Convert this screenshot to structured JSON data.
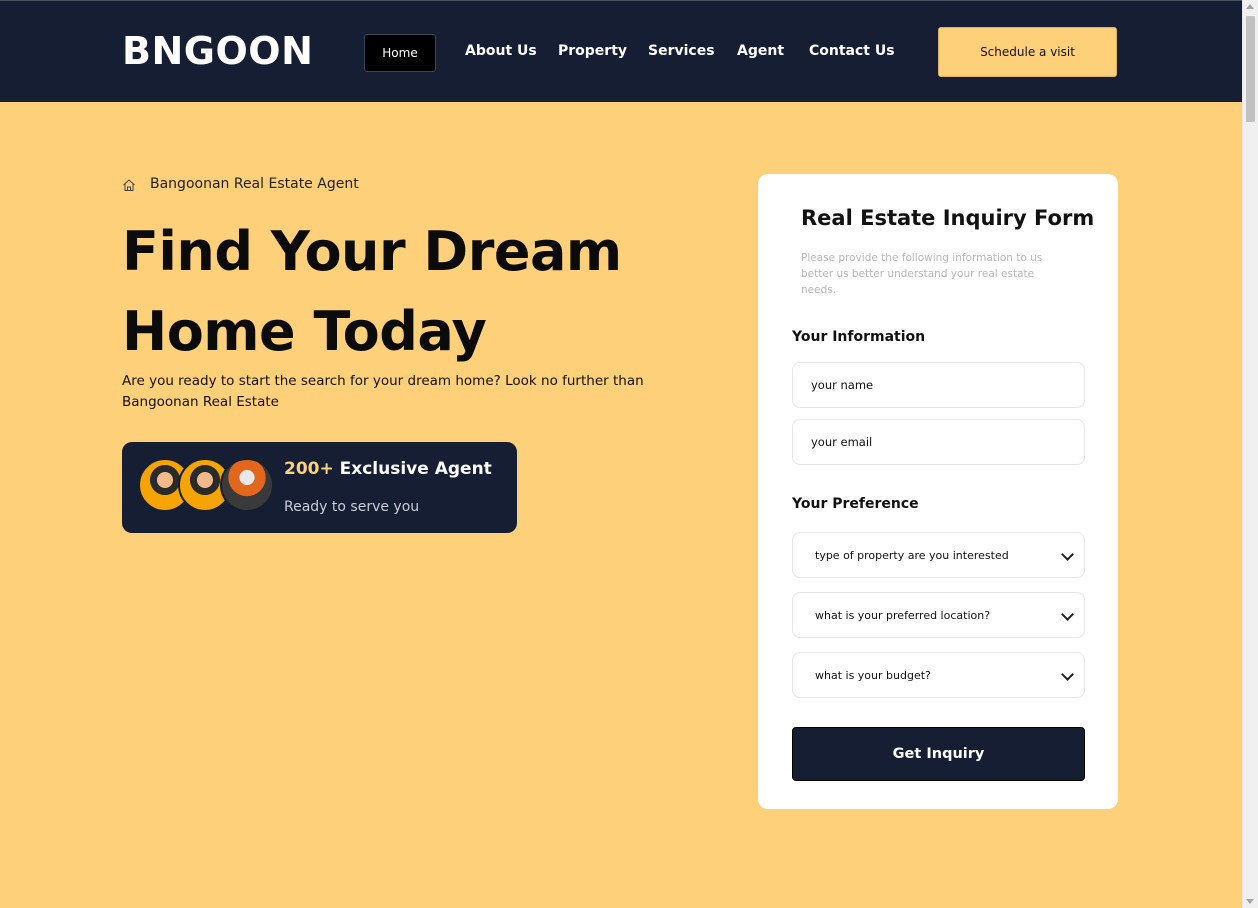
{
  "header": {
    "logo": "BNGOON",
    "nav": {
      "home": "Home",
      "about": "About Us",
      "property": "Property",
      "services": "Services",
      "agent": "Agent",
      "contact": "Contact Us"
    },
    "schedule_button": "Schedule a visit"
  },
  "hero": {
    "breadcrumb": "Bangoonan Real Estate Agent",
    "title": "Find Your Dream Home Today",
    "description": "Are you ready to start the search for your dream home? Look no further than Bangoonan Real Estate",
    "agent_card": {
      "count": "200+",
      "label": "Exclusive Agent",
      "subtitle": "Ready to serve you"
    }
  },
  "form": {
    "title": "Real Estate Inquiry Form",
    "description": "Please provide the following information to us better us better understand your real estate needs.",
    "info_label": "Your Information",
    "name_placeholder": "your name",
    "email_placeholder": "your email",
    "preference_label": "Your Preference",
    "property_type": "type of property are you interested",
    "location": "what is your preferred location?",
    "budget": "what is your budget?",
    "submit": "Get Inquiry"
  },
  "colors": {
    "accent": "#ffd07a",
    "dark": "#151e32"
  }
}
